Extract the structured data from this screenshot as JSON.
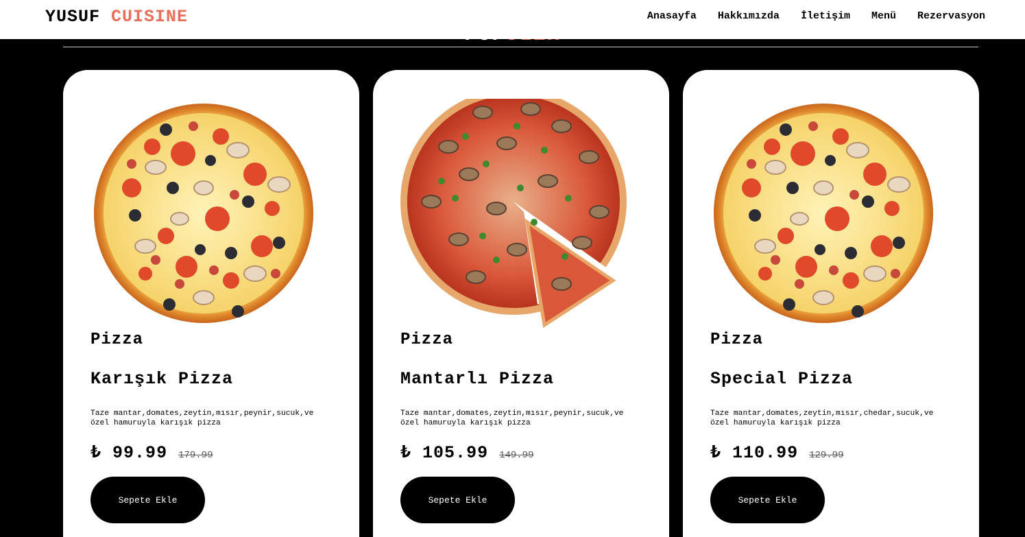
{
  "brand": {
    "name": "YUSUF",
    "accent": "CUISINE"
  },
  "nav": [
    "Anasayfa",
    "Hakkımızda",
    "İletişim",
    "Menü",
    "Rezervasyon"
  ],
  "section": {
    "title": "POP",
    "accent": "ÜLER"
  },
  "colors": {
    "accent": "#e8705a",
    "background": "#000000",
    "card": "#ffffff"
  },
  "cards": [
    {
      "image": "mixed-pizza-icon",
      "category": "Pizza",
      "name": "Karışık Pizza",
      "description": "Taze mantar,domates,zeytin,mısır,peynir,sucuk,ve özel hamuruyla karışık pizza",
      "price": "₺ 99.99",
      "old_price": "179.99",
      "button": "Sepete Ekle"
    },
    {
      "image": "mushroom-pizza-icon",
      "category": "Pizza",
      "name": "Mantarlı Pizza",
      "description": "Taze mantar,domates,zeytin,mısır,peynir,sucuk,ve özel hamuruyla karışık pizza",
      "price": "₺ 105.99",
      "old_price": "149.99",
      "button": "Sepete Ekle"
    },
    {
      "image": "mixed-pizza-icon",
      "category": "Pizza",
      "name": "Special Pizza",
      "description": "Taze mantar,domates,zeytin,mısır,chedar,sucuk,ve özel hamuruyla karışık pizza",
      "price": "₺ 110.99",
      "old_price": "129.99",
      "button": "Sepete Ekle"
    }
  ]
}
